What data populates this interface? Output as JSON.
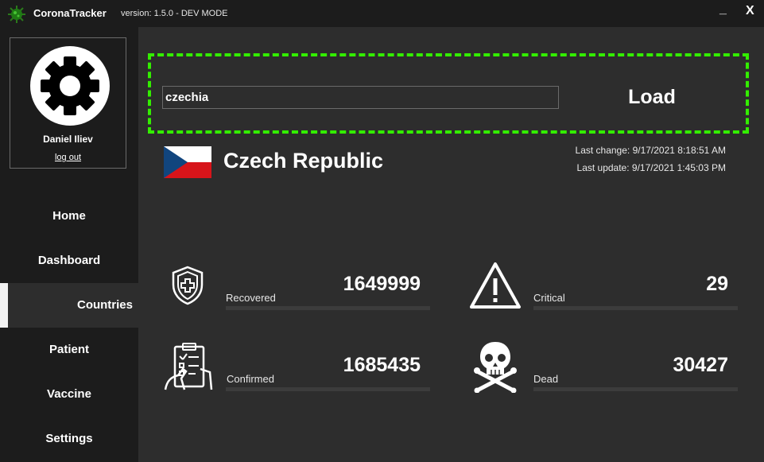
{
  "app": {
    "name": "CoronaTracker",
    "version": "version: 1.5.0 - DEV MODE",
    "minimize_label": "_",
    "close_label": "X",
    "logo_icon": "virus-icon"
  },
  "user": {
    "name": "Daniel Iliev",
    "logout_label": "log out",
    "avatar_icon": "gear-icon"
  },
  "nav": {
    "items": [
      {
        "label": "Home"
      },
      {
        "label": "Dashboard"
      },
      {
        "label": "Countries",
        "active": true
      },
      {
        "label": "Patient"
      },
      {
        "label": "Vaccine"
      },
      {
        "label": "Settings"
      }
    ]
  },
  "search": {
    "value": "czechia",
    "load_label": "Load",
    "highlight_color": "#33ee00"
  },
  "country": {
    "name": "Czech Republic",
    "flag_icon": "czech-flag-icon",
    "last_change": "Last change: 9/17/2021 8:18:51 AM",
    "last_update": "Last update: 9/17/2021 1:45:03 PM"
  },
  "stats": {
    "recovered": {
      "label": "Recovered",
      "value": "1649999",
      "icon": "shield-plus-icon"
    },
    "critical": {
      "label": "Critical",
      "value": "29",
      "icon": "warning-icon"
    },
    "confirmed": {
      "label": "Confirmed",
      "value": "1685435",
      "icon": "clipboard-icon"
    },
    "dead": {
      "label": "Dead",
      "value": "30427",
      "icon": "skull-crossbones-icon"
    }
  },
  "colors": {
    "background": "#2d2d2d",
    "sidebar": "#1c1c1c",
    "accent": "#33ee00"
  }
}
